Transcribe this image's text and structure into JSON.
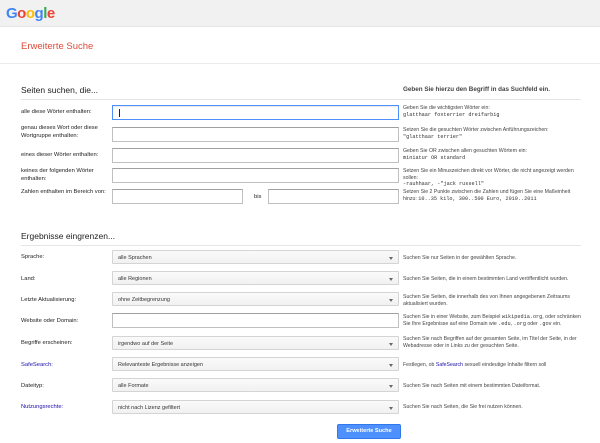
{
  "header": {
    "logo_letters": [
      {
        "char": "G",
        "color": "#4285f4"
      },
      {
        "char": "o",
        "color": "#ea4335"
      },
      {
        "char": "o",
        "color": "#fbbc05"
      },
      {
        "char": "g",
        "color": "#4285f4"
      },
      {
        "char": "l",
        "color": "#34a853"
      },
      {
        "char": "e",
        "color": "#ea4335"
      }
    ]
  },
  "page": {
    "title": "Erweiterte Suche"
  },
  "find_pages": {
    "title": "Seiten suchen, die...",
    "hint": "Geben Sie hierzu den Begriff in das Suchfeld ein.",
    "rows": [
      {
        "label": "alle diese Wörter enthalten:",
        "value": "",
        "help": "Geben Sie die wichtigsten Wörter ein:",
        "help_example": "glatthaar foxterrier dreifarbig"
      },
      {
        "label": "genau dieses Wort oder diese Wortgruppe enthalten:",
        "value": "",
        "help": "Setzen Sie die gesuchten Wörter zwischen Anführungszeichen:",
        "help_example": "\"glatthaar terrier\""
      },
      {
        "label": "eines dieser Wörter enthalten:",
        "value": "",
        "help": "Geben Sie OR zwischen allen gesuchten Wörtern ein:",
        "help_example": "miniatur OR standard"
      },
      {
        "label": "keines der folgenden Wörter enthalten:",
        "value": "",
        "help": "Setzen Sie ein Minuszeichen direkt vor Wörter, die nicht angezeigt werden sollen:",
        "help_example": "-rauhhaar, -\"jack russell\""
      },
      {
        "label": "Zahlen enthalten im Bereich von:",
        "value_from": "",
        "separator": "bis",
        "value_to": "",
        "help": "Setzen Sie 2 Punkte zwischen die Zahlen und fügen Sie eine Maßeinheit hinzu:",
        "help_example": "10..35 kilo, 300..500 Euro, 2010..2011"
      }
    ]
  },
  "narrow": {
    "title": "Ergebnisse eingrenzen...",
    "rows": [
      {
        "label": "Sprache:",
        "type": "select",
        "value": "alle Sprachen",
        "help": "Suchen Sie nur Seiten in der gewählten Sprache."
      },
      {
        "label": "Land:",
        "type": "select",
        "value": "alle Regionen",
        "help": "Suchen Sie Seiten, die in einem bestimmten Land veröffentlicht wurden."
      },
      {
        "label": "Letzte Aktualisierung:",
        "type": "select",
        "value": "ohne Zeitbegrenzung",
        "help": "Suchen Sie Seiten, die innerhalb des von Ihnen angegebenen Zeitraums aktualisiert wurden."
      },
      {
        "label": "Website oder Domain:",
        "type": "input",
        "value": "",
        "help_parts": [
          "Suchen Sie in einer Website, zum Beispiel ",
          "wikipedia.org",
          ", oder schränken Sie Ihre Ergebnisse auf eine Domain wie ",
          ".edu",
          ", ",
          ".org",
          " oder ",
          ".gov",
          " ein."
        ]
      },
      {
        "label": "Begriffe erscheinen:",
        "type": "select",
        "value": "irgendwo auf der Seite",
        "help": "Suchen Sie nach Begriffen auf der gesamten Seite, im Titel der Seite, in der Webadresse oder in Links zu der gesuchten Seite."
      },
      {
        "label": "SafeSearch:",
        "type": "select",
        "value": "Relevanteste Ergebnisse anzeigen",
        "help_pre": "Festlegen, ob ",
        "help_link": "SafeSearch",
        "help_post": " sexuell eindeutige Inhalte filtern soll"
      },
      {
        "label": "Dateityp:",
        "type": "select",
        "value": "alle Formate",
        "help": "Suchen Sie nach Seiten mit einem bestimmten Dateiformat."
      },
      {
        "label": "Nutzungsrechte:",
        "type": "select",
        "value": "nicht nach Lizenz gefiltert",
        "help": "Suchen Sie nach Seiten, die Sie frei nutzen können."
      }
    ]
  },
  "submit_label": "Erweiterte Suche",
  "colors": {
    "accent": "#dd4b39",
    "link": "#1a0dab",
    "button": "#4d90fe"
  }
}
